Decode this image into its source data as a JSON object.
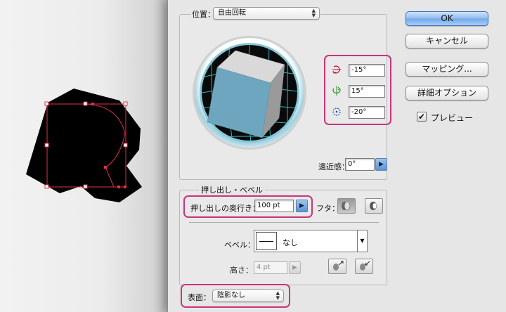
{
  "position": {
    "label": "位置：",
    "value": "自由回転"
  },
  "rotation": {
    "x_value": "-15°",
    "y_value": "15°",
    "z_value": "-20°",
    "x_icon": "rotate-x-icon",
    "y_icon": "rotate-y-icon",
    "z_icon": "rotate-z-icon"
  },
  "perspective": {
    "label": "遠近感：",
    "value": "0°"
  },
  "extrude_bevel": {
    "title": "押し出し・ベベル",
    "depth_label": "押し出しの奥行き：",
    "depth_value": "100 pt",
    "cap_label": "フタ：",
    "bevel_label": "ベベル：",
    "bevel_value": "なし",
    "height_label": "高さ：",
    "height_value": "4 pt"
  },
  "surface": {
    "label": "表面：",
    "value": "陰影なし"
  },
  "buttons": {
    "ok": "OK",
    "cancel": "キャンセル",
    "mapping": "マッピング...",
    "more_options": "詳細オプション"
  },
  "preview": {
    "label": "プレビュー",
    "checked": true
  },
  "colors": {
    "highlight": "#c8357a",
    "cube_front": "#6ea6bf",
    "grid": "#2bb3c0",
    "anchor": "#e0314a"
  }
}
